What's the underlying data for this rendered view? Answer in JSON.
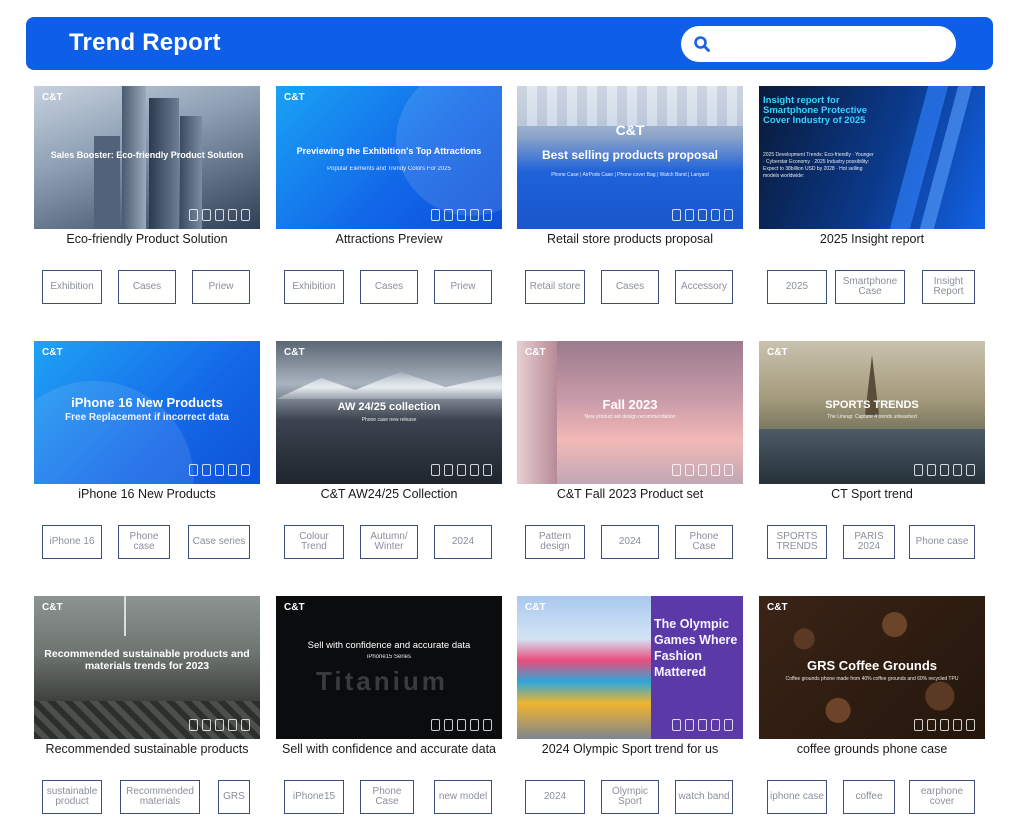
{
  "header": {
    "title": "Trend Report",
    "search_placeholder": ""
  },
  "cards": [
    {
      "caption": "Eco-friendly Product Solution",
      "thumb": {
        "brand": "C&T",
        "headline": "Sales Booster:  Eco-friendly Product Solution",
        "sub": ""
      },
      "tags": [
        "Exhibition",
        "Cases",
        "Priew"
      ]
    },
    {
      "caption": "Attractions Preview",
      "thumb": {
        "brand": "C&T",
        "headline": "Previewing the Exhibition's Top Attractions",
        "sub": "Popular Elements and Trendy Colors For 2025"
      },
      "tags": [
        "Exhibition",
        "Cases",
        "Priew"
      ]
    },
    {
      "caption": "Retail store products proposal",
      "thumb": {
        "brand": "C&T",
        "headline": "Best selling products proposal",
        "sub": "Phone Case | AirPods Case | Phone cover Bag | Watch Band | Lanyard"
      },
      "tags": [
        "Retail store",
        "Cases",
        "Accessory"
      ]
    },
    {
      "caption": "2025 Insight report",
      "thumb": {
        "brand": "",
        "headline": "Insight report for Smartphone Protective Cover Industry of 2025",
        "sub": "2025 Development Trends: Eco-friendly · Younger · Cyberstar Economy · 2025 Industry possibility: Expect to 38billion USD by 2028 · Hot selling models worldwide:"
      },
      "tags": [
        "2025",
        "Smartphone Case",
        "Insight Report"
      ]
    },
    {
      "caption": "iPhone 16 New Products",
      "thumb": {
        "brand": "C&T",
        "headline": "iPhone 16 New Products",
        "sub": "Free Replacement if incorrect data"
      },
      "tags": [
        "iPhone 16",
        "Phone case",
        "Case series"
      ]
    },
    {
      "caption": "C&T AW24/25 Collection",
      "thumb": {
        "brand": "C&T",
        "headline": "AW 24/25 collection",
        "sub": "Phone case new release"
      },
      "tags": [
        "Colour Trend",
        "Autumn/ Winter",
        "2024"
      ]
    },
    {
      "caption": "C&T Fall 2023 Product set",
      "thumb": {
        "brand": "C&T",
        "headline": "Fall 2023",
        "sub": "New product set design recommendation"
      },
      "tags": [
        "Pattern design",
        "2024",
        "Phone Case"
      ]
    },
    {
      "caption": "CT Sport trend",
      "thumb": {
        "brand": "C&T",
        "headline": "SPORTS TRENDS",
        "sub": "The Lineup: Capture 4 trends unleashed"
      },
      "tags": [
        "SPORTS TRENDS",
        "PARIS 2024",
        "Phone case"
      ]
    },
    {
      "caption": "Recommended sustainable products",
      "thumb": {
        "brand": "C&T",
        "headline": "Recommended sustainable products and materials trends for 2023",
        "sub": ""
      },
      "tags": [
        "sustainable product",
        "Recommended materials",
        "GRS"
      ]
    },
    {
      "caption": "Sell with confidence and accurate data",
      "thumb": {
        "brand": "C&T",
        "headline": "Sell with confidence and accurate data",
        "sub": "iPhone15 Series"
      },
      "tags": [
        "iPhone15",
        "Phone Case",
        "new model"
      ]
    },
    {
      "caption": "2024 Olympic Sport trend for us",
      "thumb": {
        "brand": "C&T",
        "headline": "The Olympic Games Where Fashion Mattered",
        "sub": ""
      },
      "tags": [
        "2024",
        "Olympic Sport",
        "watch band"
      ]
    },
    {
      "caption": "coffee grounds phone case",
      "thumb": {
        "brand": "C&T",
        "headline": "GRS Coffee Grounds",
        "sub": "Coffee grounds phone made from 40% coffee grounds and 60% recycled TPU"
      },
      "tags": [
        "iphone case",
        "coffee",
        "earphone cover"
      ]
    }
  ],
  "colors": {
    "header_bg": "#0f5ee8",
    "tag_border": "#3d4e7a",
    "tag_text": "#8a8f9c"
  }
}
